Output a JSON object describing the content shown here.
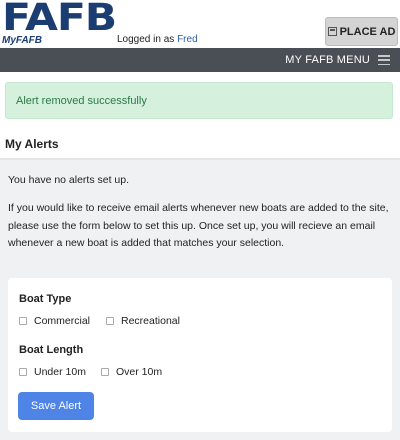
{
  "header": {
    "logo_text": "FAFB",
    "logo_sub": "MyFAFB",
    "login_prefix": "Logged in as",
    "user_name": "Fred",
    "place_ad_label": "PLACE AD"
  },
  "navbar": {
    "menu_label": "MY FAFB MENU"
  },
  "alert": {
    "message": "Alert removed successfully"
  },
  "main": {
    "title": "My Alerts",
    "no_alerts": "You have no alerts set up.",
    "description": "If you would like to receive email alerts whenever new boats are added to the site, please use the form below to set this up. Once set up, you will recieve an email whenever a new boat is added that matches your selection."
  },
  "form": {
    "boat_type": {
      "label": "Boat Type",
      "options": [
        "Commercial",
        "Recreational"
      ]
    },
    "boat_length": {
      "label": "Boat Length",
      "options": [
        "Under 10m",
        "Over 10m"
      ]
    },
    "submit_label": "Save Alert"
  },
  "colors": {
    "brand": "#1b3d72",
    "navbar": "#4a4e55",
    "success_bg": "#d5f0dc",
    "success_text": "#2a7a45",
    "primary_button": "#4e84e6"
  }
}
